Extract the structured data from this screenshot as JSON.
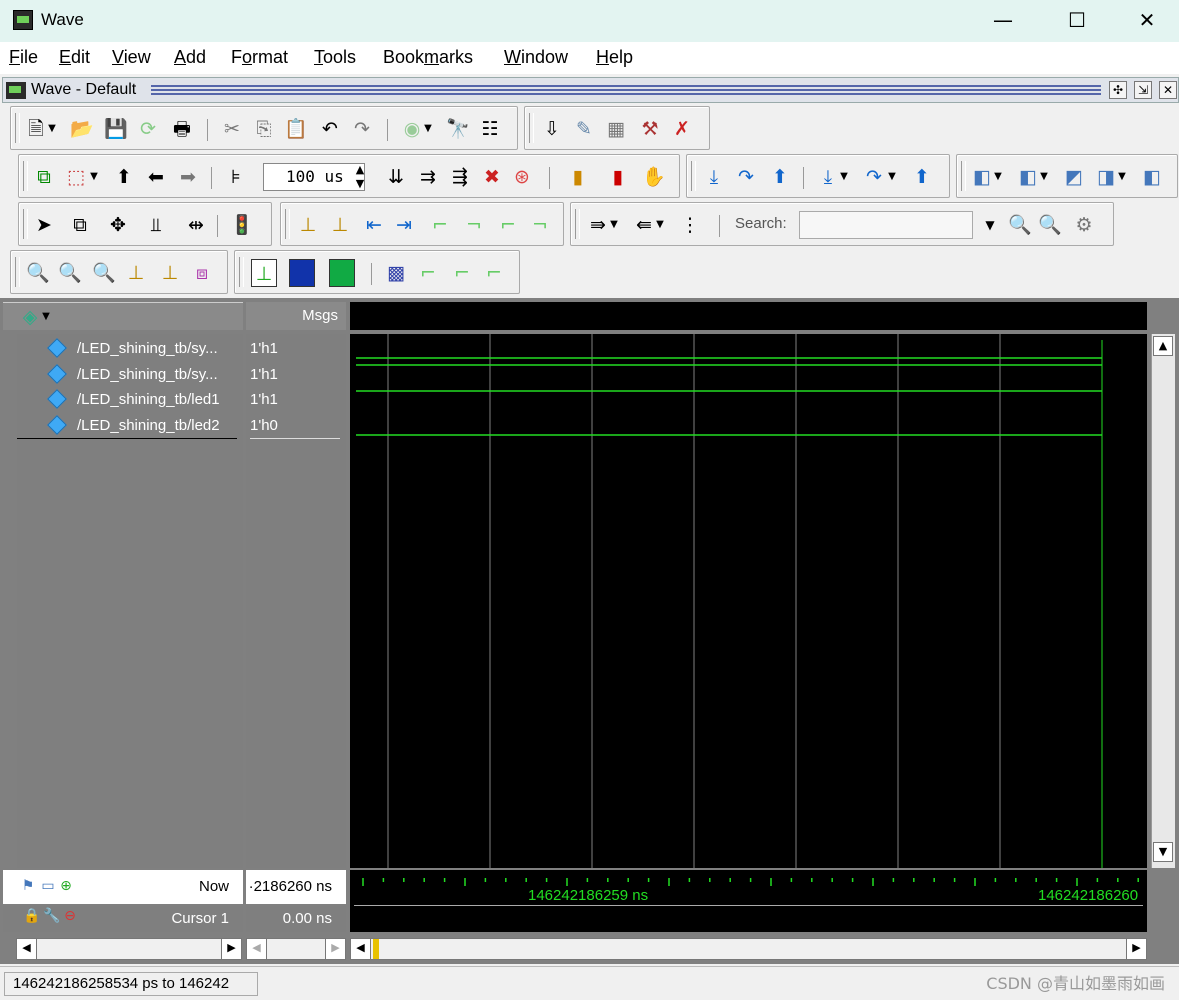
{
  "window": {
    "title": "Wave",
    "minimize": "—",
    "maximize": "☐",
    "close": "✕"
  },
  "menu": [
    {
      "label": "File",
      "u": "F",
      "rest": "ile"
    },
    {
      "label": "Edit",
      "u": "E",
      "rest": "dit"
    },
    {
      "label": "View",
      "u": "V",
      "rest": "iew"
    },
    {
      "label": "Add",
      "u": "A",
      "rest": "dd"
    },
    {
      "label": "Format",
      "pre": "F",
      "u": "o",
      "rest": "rmat"
    },
    {
      "label": "Tools",
      "u": "T",
      "rest": "ools"
    },
    {
      "label": "Bookmarks",
      "pre": "Book",
      "u": "m",
      "rest": "arks"
    },
    {
      "label": "Window",
      "u": "W",
      "rest": "indow"
    },
    {
      "label": "Help",
      "u": "H",
      "rest": "elp"
    }
  ],
  "wave_window": {
    "title": "Wave - Default"
  },
  "toolbar": {
    "run_length": "100 us",
    "search_label": "Search:",
    "search_placeholder": ""
  },
  "columns": {
    "msgs": "Msgs"
  },
  "signals": [
    {
      "name": "/LED_shining_tb/sy...",
      "value": "1'h1"
    },
    {
      "name": "/LED_shining_tb/sy...",
      "value": "1'h1"
    },
    {
      "name": "/LED_shining_tb/led1",
      "value": "1'h1"
    },
    {
      "name": "/LED_shining_tb/led2",
      "value": "1'h0"
    }
  ],
  "now": {
    "label": "Now",
    "value": "·2186260 ns"
  },
  "cursor": {
    "label": "Cursor 1",
    "value": "0.00 ns"
  },
  "timeline": {
    "label1": "146242186259 ns",
    "label2": "146242186260"
  },
  "status": {
    "range": "146242186258534 ps to 146242"
  },
  "watermark": "CSDN @青山如墨雨如画",
  "colors": {
    "signal": "#22dd22",
    "grid": "#808080",
    "cursor": "#22dd22"
  }
}
